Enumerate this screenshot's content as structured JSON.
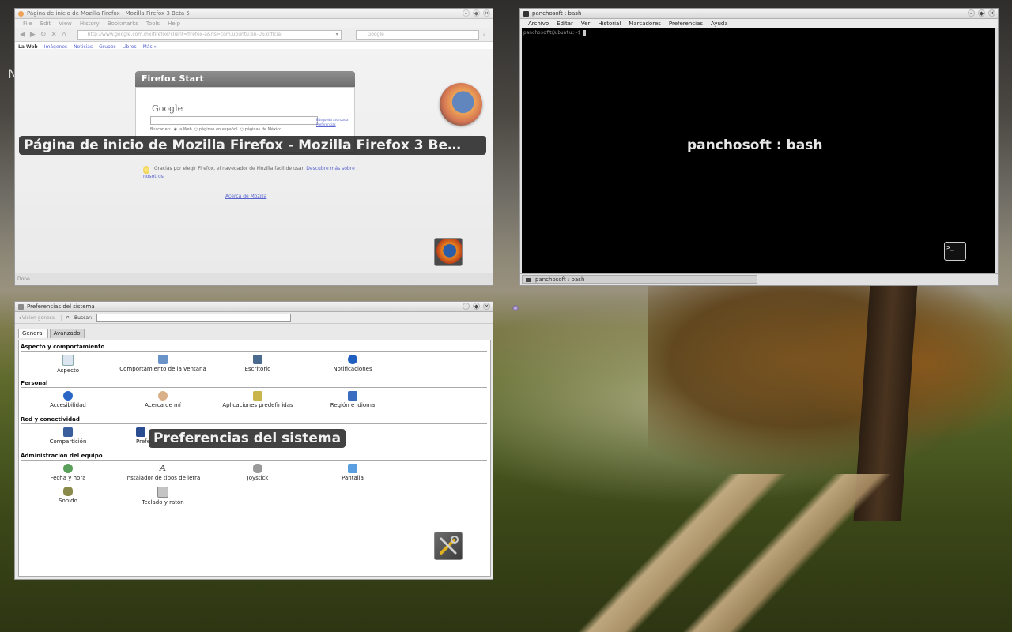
{
  "desktop": {
    "letter": "N"
  },
  "firefox": {
    "title": "Página de inicio de Mozilla Firefox - Mozilla Firefox 3 Beta 5",
    "menu": [
      "File",
      "Edit",
      "View",
      "History",
      "Bookmarks",
      "Tools",
      "Help"
    ],
    "url": "http://www.google.com.mx/firefox?client=firefox-a&rls=com.ubuntu:en-US:official",
    "search_placeholder": "Google",
    "google_bar": [
      "La Web",
      "Imágenes",
      "Noticias",
      "Grupos",
      "Libros",
      "Más »"
    ],
    "start_title": "Firefox Start",
    "google_logo": "Google",
    "google_links": "Búsqueda avanzada Preferencias",
    "search_in_label": "Buscar en:",
    "radio_options": [
      "la Web",
      "páginas en español",
      "páginas de México"
    ],
    "thanks_text": "Gracias por elegir Firefox, el navegador de Mozilla fácil de usar.",
    "thanks_link": "Descubre más sobre nosotros",
    "about_link": "Acerca de Mozilla",
    "status": "Done",
    "overlay_label": "Página de inicio de Mozilla Firefox - Mozilla Firefox 3 Be…"
  },
  "terminal": {
    "title": "panchosoft : bash",
    "menu": [
      "Archivo",
      "Editar",
      "Ver",
      "Historial",
      "Marcadores",
      "Preferencias",
      "Ayuda"
    ],
    "prompt": "panchosoft@ubuntu:~$ ",
    "tab_label": "panchosoft : bash",
    "overlay_label": "panchosoft : bash",
    "badge_text": ">_"
  },
  "prefs": {
    "title": "Preferencias del sistema",
    "back_label": "Visión general",
    "search_label": "Buscar:",
    "tabs": [
      "General",
      "Avanzado"
    ],
    "sections": [
      {
        "title": "Aspecto y comportamiento",
        "items": [
          "Aspecto",
          "Comportamiento de la ventana",
          "Escritorio",
          "Notificaciones"
        ]
      },
      {
        "title": "Personal",
        "items": [
          "Accesibilidad",
          "Acerca de mí",
          "Aplicaciones predefinidas",
          "Región e idioma"
        ]
      },
      {
        "title": "Red y conectividad",
        "items": [
          "Compartición",
          "Prefe"
        ]
      },
      {
        "title": "Administración del equipo",
        "items": [
          "Fecha y hora",
          "Instalador de tipos de letra",
          "Joystick",
          "Pantalla",
          "Sonido",
          "Teclado y ratón"
        ]
      }
    ],
    "overlay_label": "Preferencias del sistema"
  },
  "colors": {
    "overlay_bg": "#282828",
    "link": "#2030c0",
    "terminal_bg": "#000000"
  }
}
